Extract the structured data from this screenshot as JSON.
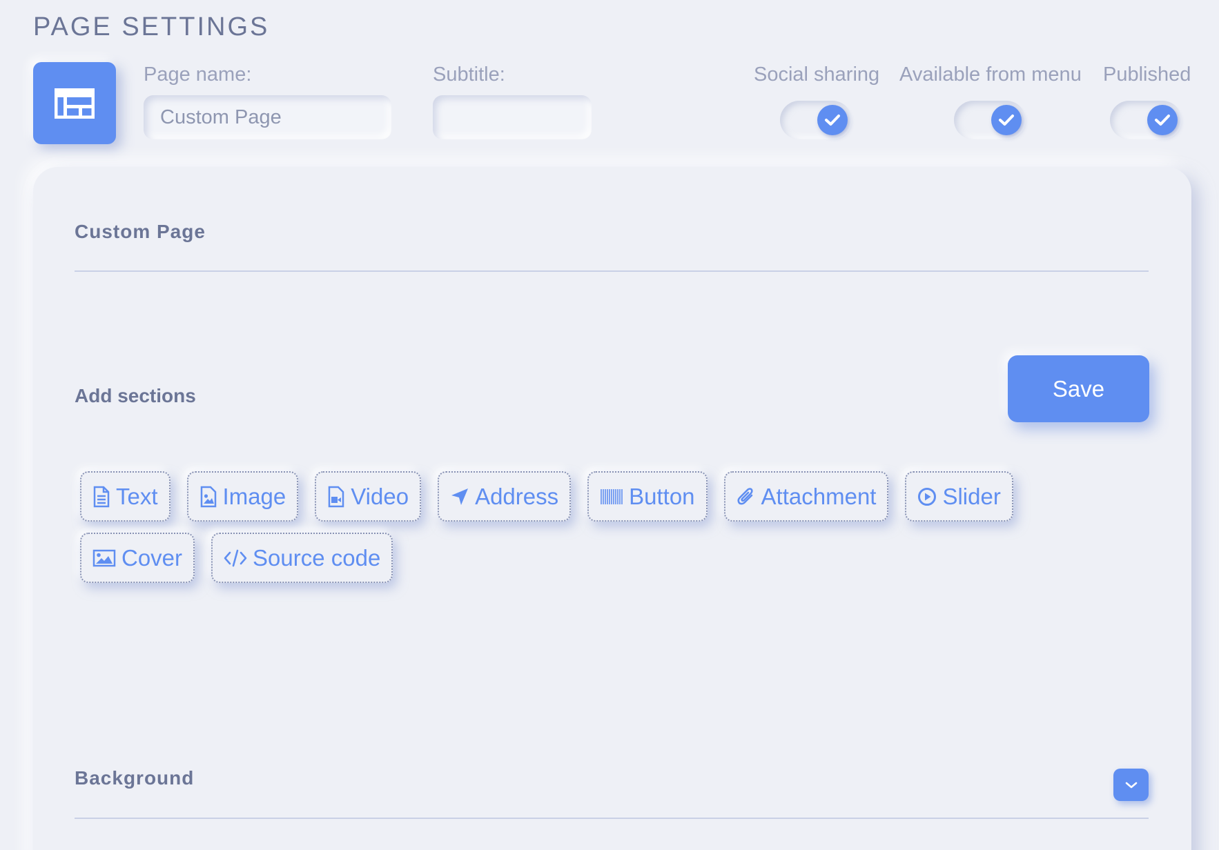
{
  "header": {
    "title": "PAGE SETTINGS",
    "icon": "layout-icon"
  },
  "form": {
    "page_name": {
      "label": "Page name:",
      "value": "Custom Page"
    },
    "subtitle": {
      "label": "Subtitle:",
      "value": ""
    }
  },
  "toggles": [
    {
      "label": "Social sharing",
      "checked": true
    },
    {
      "label": "Available from menu",
      "checked": true
    },
    {
      "label": "Published",
      "checked": true
    }
  ],
  "card": {
    "title": "Custom Page",
    "add_sections_label": "Add sections",
    "save_label": "Save",
    "sections": [
      {
        "label": "Text",
        "icon": "file-text-icon"
      },
      {
        "label": "Image",
        "icon": "file-image-icon"
      },
      {
        "label": "Video",
        "icon": "file-video-icon"
      },
      {
        "label": "Address",
        "icon": "location-arrow-icon"
      },
      {
        "label": "Button",
        "icon": "barcode-icon"
      },
      {
        "label": "Attachment",
        "icon": "paperclip-icon"
      },
      {
        "label": "Slider",
        "icon": "play-circle-icon"
      },
      {
        "label": "Cover",
        "icon": "image-icon"
      },
      {
        "label": "Source code",
        "icon": "code-icon"
      }
    ],
    "background_label": "Background",
    "expand_icon": "chevron-down-icon"
  },
  "colors": {
    "accent": "#5f8ef1",
    "background": "#eef0f6",
    "text": "#6b7596",
    "muted": "#9aa1bb"
  }
}
